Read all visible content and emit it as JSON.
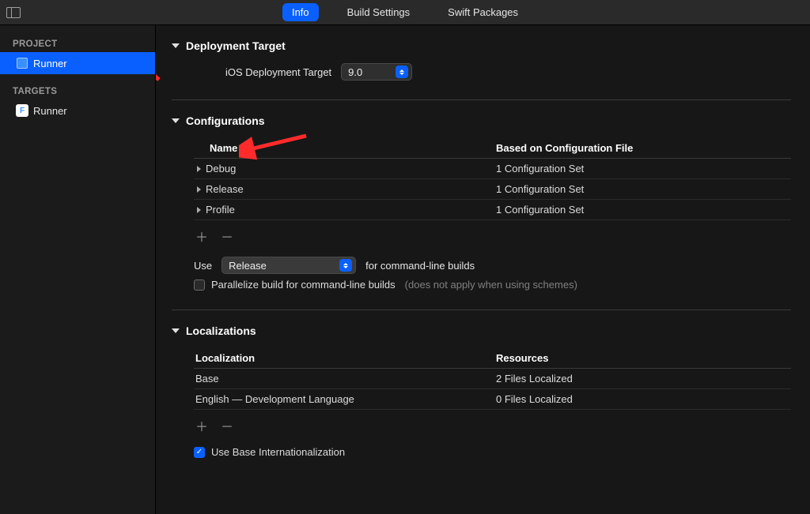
{
  "tabs": {
    "info": "Info",
    "build": "Build Settings",
    "packages": "Swift Packages"
  },
  "sidebar": {
    "project_header": "PROJECT",
    "targets_header": "TARGETS",
    "project_item": "Runner",
    "target_item": "Runner"
  },
  "deployment": {
    "title": "Deployment Target",
    "ios_label": "iOS Deployment Target",
    "ios_value": "9.0"
  },
  "configurations": {
    "title": "Configurations",
    "col_name": "Name",
    "col_file": "Based on Configuration File",
    "rows": [
      {
        "name": "Debug",
        "detail": "1 Configuration Set"
      },
      {
        "name": "Release",
        "detail": "1 Configuration Set"
      },
      {
        "name": "Profile",
        "detail": "1 Configuration Set"
      }
    ],
    "use_label": "Use",
    "use_value": "Release",
    "use_suffix": "for command-line builds",
    "parallelize": "Parallelize build for command-line builds",
    "parallelize_hint": "(does not apply when using schemes)"
  },
  "localizations": {
    "title": "Localizations",
    "col_loc": "Localization",
    "col_res": "Resources",
    "rows": [
      {
        "loc": "Base",
        "res": "2 Files Localized"
      },
      {
        "loc": "English — Development Language",
        "res": "0 Files Localized"
      }
    ],
    "use_base": "Use Base Internationalization"
  }
}
